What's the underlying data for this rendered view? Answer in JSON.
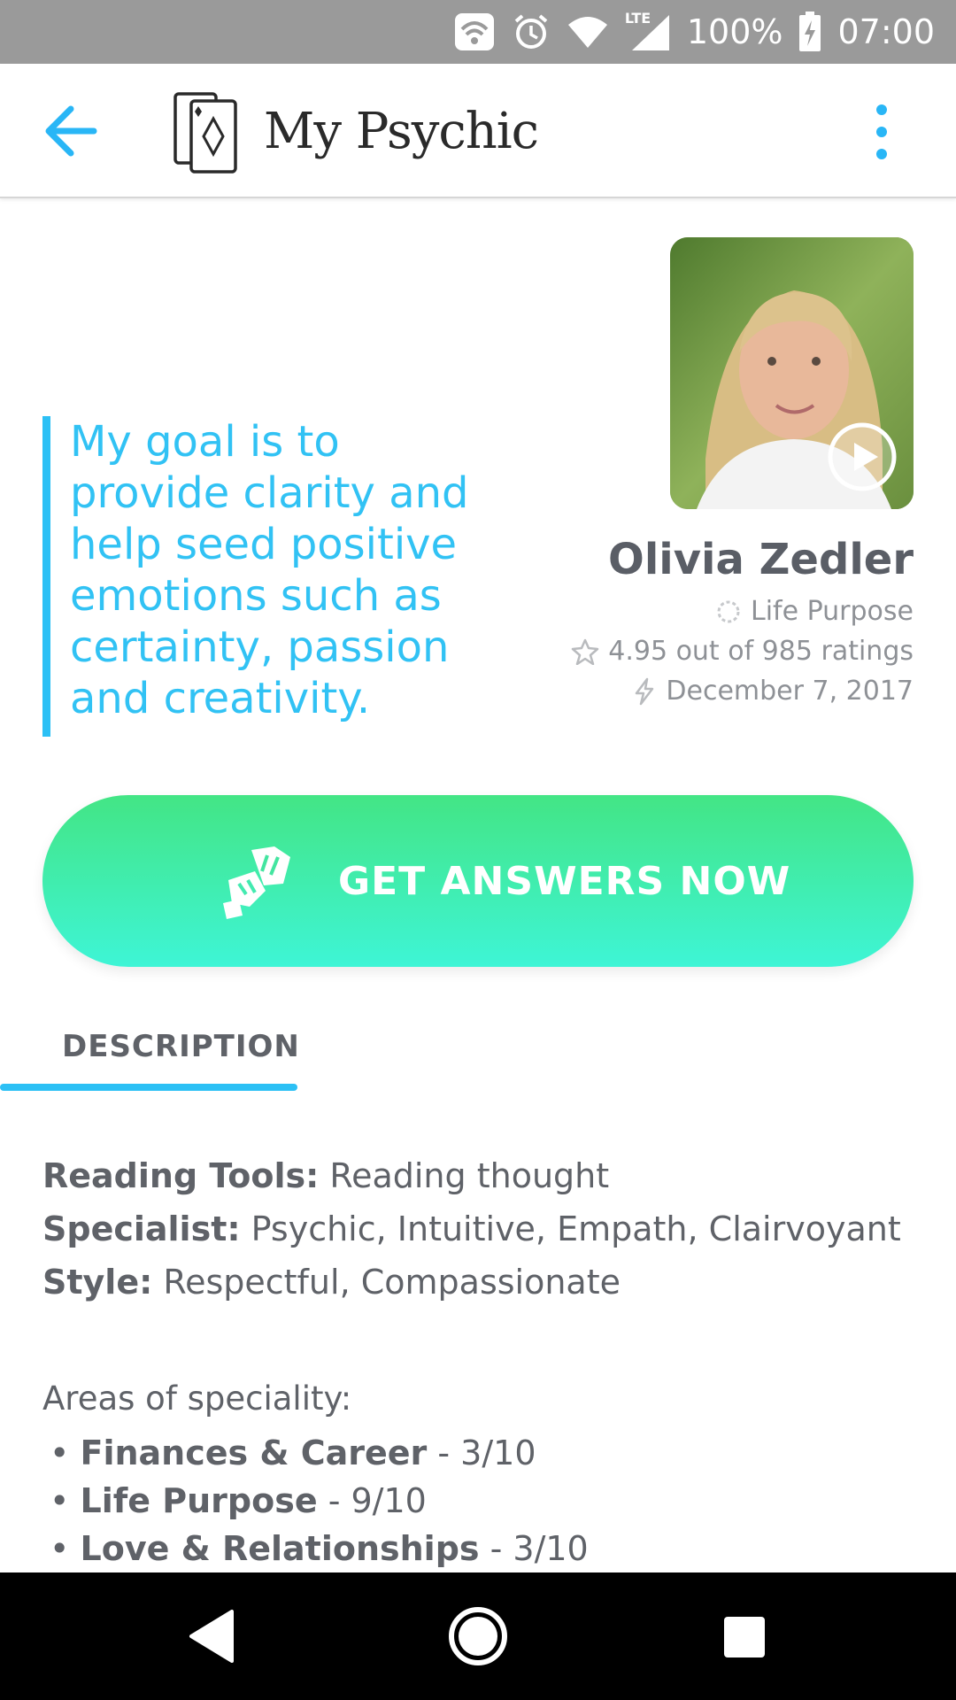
{
  "status_bar": {
    "battery": "100%",
    "time": "07:00",
    "network_label": "LTE"
  },
  "app_bar": {
    "title": "My Psychic"
  },
  "profile": {
    "quote": "My goal is to provide clarity and help seed positive emotions such as certainty, passion and creativity.",
    "name": "Olivia Zedler",
    "category": "Life Purpose",
    "rating": "4.95 out of 985 ratings",
    "joined": "December 7, 2017"
  },
  "cta": {
    "label": "GET ANSWERS NOW"
  },
  "tabs": {
    "description": "DESCRIPTION"
  },
  "description": {
    "reading_tools_label": "Reading Tools:",
    "reading_tools_value": " Reading thought",
    "specialist_label": "Specialist:",
    "specialist_value": " Psychic, Intuitive, Empath, Clairvoyant",
    "style_label": "Style:",
    "style_value": " Respectful, Compassionate",
    "areas_heading": "Areas of speciality:",
    "areas": [
      {
        "name": "Finances & Career",
        "score": " - 3/10"
      },
      {
        "name": "Life Purpose",
        "score": " - 9/10"
      },
      {
        "name": "Love & Relationships",
        "score": " - 3/10"
      }
    ]
  },
  "colors": {
    "accent": "#2cc0f5",
    "cta_top": "#43e585",
    "cta_bottom": "#3ef5d6",
    "status_bar": "#9a9a9a"
  },
  "icons": {
    "back": "arrow-left-icon",
    "logo": "cards-icon",
    "menu": "more-vert-icon",
    "play": "play-circle-icon",
    "category": "spinner-icon",
    "rating": "star-icon",
    "joined": "lightning-icon",
    "cta": "fist-bump-icon"
  }
}
